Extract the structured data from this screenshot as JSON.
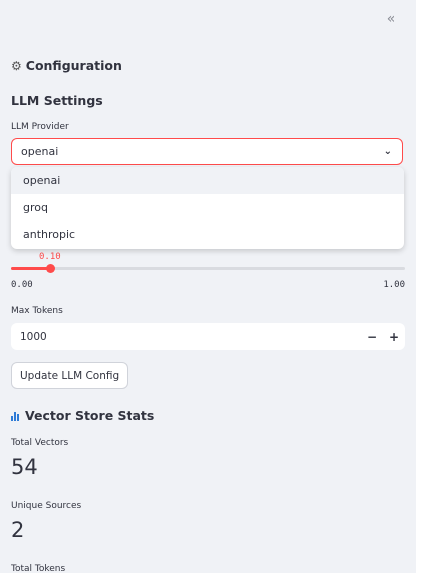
{
  "sidebar": {
    "collapse_icon": "«",
    "config_header": {
      "icon": "⚙",
      "title": "Configuration"
    },
    "llm_settings_title": "LLM Settings",
    "llm_provider": {
      "label": "LLM Provider",
      "selected": "openai",
      "options": [
        "openai",
        "groq",
        "anthropic"
      ]
    },
    "temperature": {
      "value_text": "0.10",
      "value": 0.1,
      "min_text": "0.00",
      "max_text": "1.00",
      "min": 0,
      "max": 1
    },
    "max_tokens": {
      "label": "Max Tokens",
      "value": "1000",
      "minus": "−",
      "plus": "+"
    },
    "update_button": "Update LLM Config",
    "vector_stats": {
      "title": "Vector Store Stats",
      "metrics": [
        {
          "label": "Total Vectors",
          "value": "54"
        },
        {
          "label": "Unique Sources",
          "value": "2"
        },
        {
          "label": "Total Tokens",
          "value": ""
        }
      ]
    }
  },
  "colors": {
    "accent": "#ff4b4b",
    "sidebar_bg": "#f0f2f6",
    "text": "#31333f"
  }
}
